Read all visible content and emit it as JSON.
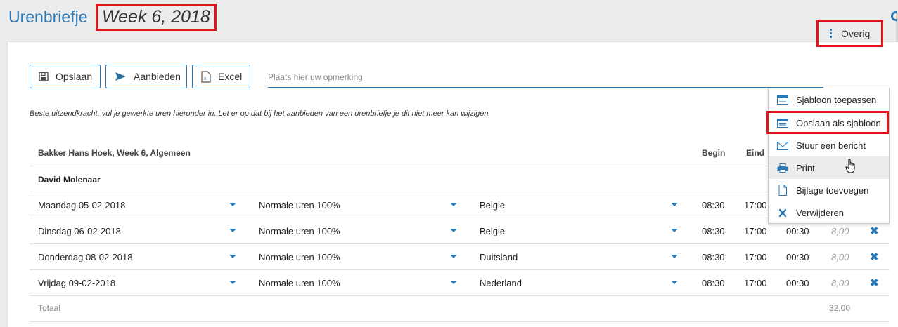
{
  "header": {
    "title": "Urenbriefje",
    "week": "Week 6, 2018"
  },
  "toolbar": {
    "save_label": "Opslaan",
    "offer_label": "Aanbieden",
    "excel_label": "Excel",
    "remark_placeholder": "Plaats hier uw opmerking",
    "more_label": "Overig"
  },
  "hint": "Beste uitzendkracht, vul je gewerkte uren hieronder in. Let er op dat bij het aanbieden van een urenbriefje je dit niet meer kan wijzigen.",
  "table": {
    "group_title": "Bakker Hans Hoek, Week 6, Algemeen",
    "columns": {
      "begin": "Begin",
      "end": "Eind"
    },
    "employee": "David Molenaar",
    "rows": [
      {
        "day": "Maandag 05-02-2018",
        "type": "Normale uren 100%",
        "country": "Belgie",
        "begin": "08:30",
        "end": "17:00",
        "pause": "",
        "hours": ""
      },
      {
        "day": "Dinsdag 06-02-2018",
        "type": "Normale uren 100%",
        "country": "Belgie",
        "begin": "08:30",
        "end": "17:00",
        "pause": "00:30",
        "hours": "8,00"
      },
      {
        "day": "Donderdag 08-02-2018",
        "type": "Normale uren 100%",
        "country": "Duitsland",
        "begin": "08:30",
        "end": "17:00",
        "pause": "00:30",
        "hours": "8,00"
      },
      {
        "day": "Vrijdag 09-02-2018",
        "type": "Normale uren 100%",
        "country": "Nederland",
        "begin": "08:30",
        "end": "17:00",
        "pause": "00:30",
        "hours": "8,00"
      }
    ],
    "total_label": "Totaal",
    "total_value": "32,00"
  },
  "menu": {
    "items": [
      {
        "label": "Sjabloon toepassen",
        "icon": "template-icon"
      },
      {
        "label": "Opslaan als sjabloon",
        "icon": "template-icon"
      },
      {
        "label": "Stuur een bericht",
        "icon": "envelope-icon"
      },
      {
        "label": "Print",
        "icon": "printer-icon"
      },
      {
        "label": "Bijlage toevoegen",
        "icon": "document-icon"
      },
      {
        "label": "Verwijderen",
        "icon": "close-icon"
      }
    ]
  },
  "colors": {
    "accent": "#2a79b8",
    "highlight": "#e0141b"
  }
}
